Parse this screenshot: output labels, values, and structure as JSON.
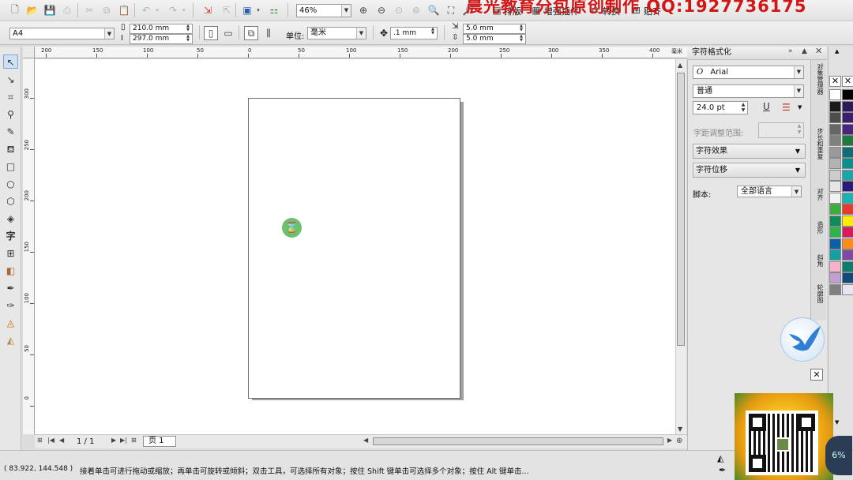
{
  "toolbar": {
    "zoom": "46%",
    "menu_items": [
      "排版",
      "增强插件",
      "转换",
      "贴齐"
    ],
    "watermark": "晨光教育分包原创制作 QQ:1927736175"
  },
  "property_bar": {
    "paper_size": "A4",
    "width": "210.0 mm",
    "height": "297.0 mm",
    "unit_label": "单位:",
    "unit": "毫米",
    "nudge": ".1 mm",
    "dup_x": "5.0 mm",
    "dup_y": "5.0 mm"
  },
  "rulers": {
    "top_ticks": [
      "200",
      "150",
      "100",
      "50",
      "0",
      "50",
      "100",
      "150",
      "200",
      "250",
      "300",
      "350",
      "400"
    ],
    "top_unit": "毫米",
    "left_ticks": [
      "300",
      "250",
      "200",
      "150",
      "100",
      "50",
      "0"
    ]
  },
  "docker": {
    "title": "字符格式化",
    "font": "Arial",
    "style": "普通",
    "size": "24.0 pt",
    "kerning_label": "字距调整范围:",
    "effects": "字符效果",
    "offset": "字符位移",
    "script_label": "脚本:",
    "script_value": "全部语言",
    "tabs": [
      "对象管理器",
      "步长和重复",
      "对齐",
      "造形",
      "斜角",
      "轮廓图"
    ]
  },
  "page_nav": {
    "count": "1 / 1",
    "tab": "页 1"
  },
  "status": {
    "coords": "( 83.922, 144.548 )",
    "message": "接着单击可进行拖动或缩放；再单击可旋转或倾斜；双击工具，可选择所有对象；按住 Shift 键单击可选择多个对象；按住 Alt 键单击..."
  },
  "palette": {
    "colors": [
      "#ffffff",
      "#000000",
      "#1a1a1a",
      "#2d1a5a",
      "#4d4d4d",
      "#3b1e6e",
      "#666666",
      "#4a2580",
      "#808080",
      "#1e7a3c",
      "#999999",
      "#0e6e73",
      "#b3b3b3",
      "#0a8f95",
      "#cccccc",
      "#1aa6a6",
      "#e6e6e6",
      "#2a1a7a",
      "#f2f2f2",
      "#19b3b3",
      "#3ab03a",
      "#e63a2e",
      "#108a5a",
      "#ffee00",
      "#2db34a",
      "#d81b60",
      "#0d5fa6",
      "#ff8c1a",
      "#12a0a0",
      "#7a4aa6",
      "#f5b3c8",
      "#0f7a6e",
      "#c0a0d0",
      "#104a7a",
      "#808080",
      "#e6e6f0"
    ]
  },
  "overlay": {
    "gauge_text": "6%"
  }
}
